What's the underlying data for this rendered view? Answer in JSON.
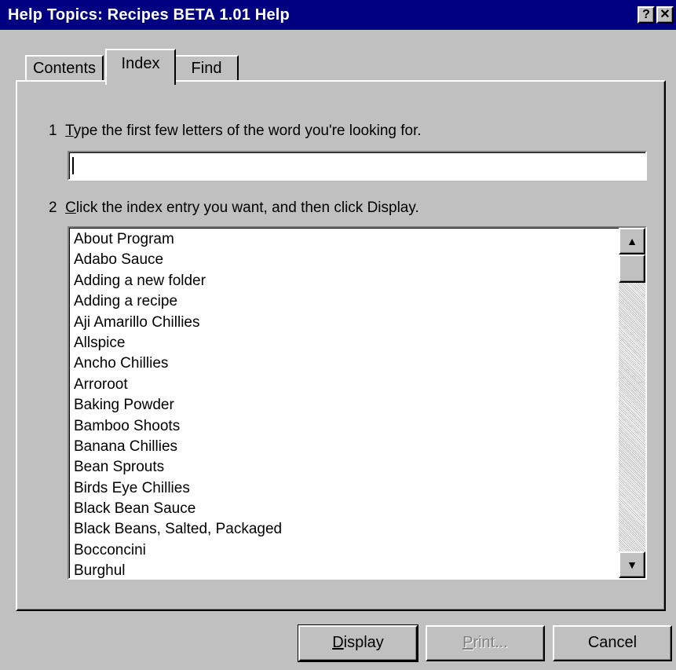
{
  "window": {
    "title": "Help Topics: Recipes BETA 1.01 Help",
    "help_button": "?",
    "close_button": "✕"
  },
  "tabs": [
    {
      "label": "Contents",
      "selected": false
    },
    {
      "label": "Index",
      "selected": true
    },
    {
      "label": "Find",
      "selected": false
    }
  ],
  "step1": {
    "number": "1",
    "accel": "T",
    "rest": "ype the first few letters of the word you're looking for."
  },
  "search": {
    "value": "",
    "placeholder": ""
  },
  "step2": {
    "number": "2",
    "accel": "C",
    "rest": "lick the index entry you want, and then click Display."
  },
  "index_entries": [
    "About Program",
    "Adabo Sauce",
    "Adding a new folder",
    "Adding a recipe",
    "Aji Amarillo Chillies",
    "Allspice",
    "Ancho Chillies",
    "Arroroot",
    "Baking Powder",
    "Bamboo Shoots",
    "Banana Chillies",
    "Bean Sprouts",
    "Birds Eye Chillies",
    "Black Bean Sauce",
    "Black Beans, Salted, Packaged",
    "Bocconcini",
    "Burghul"
  ],
  "scrollbar": {
    "up_icon": "▲",
    "down_icon": "▼"
  },
  "buttons": {
    "display_accel": "D",
    "display_rest": "isplay",
    "print_accel": "P",
    "print_rest": "rint...",
    "print_enabled": false,
    "cancel": "Cancel"
  },
  "colors": {
    "title_bar": "#000080",
    "face": "#c0c0c0",
    "disabled_text": "#808080"
  }
}
